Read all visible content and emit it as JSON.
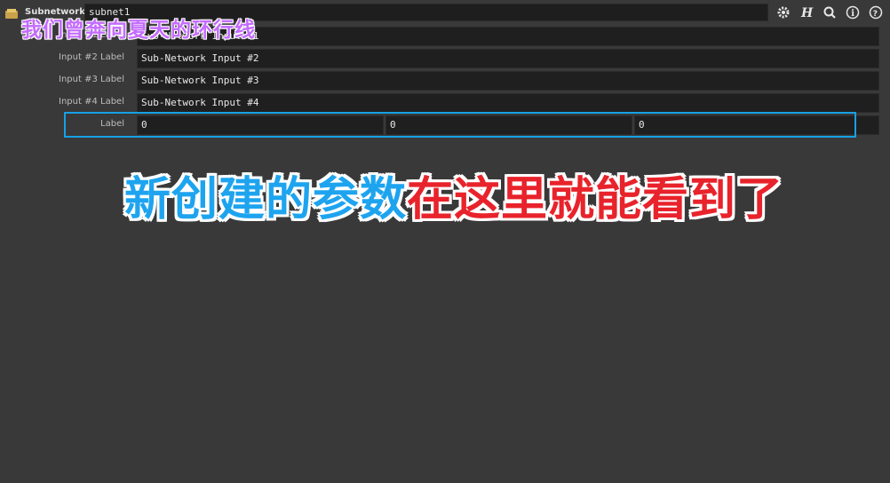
{
  "header": {
    "node_type": "Subnetwork",
    "node_name": "subnet1",
    "icons": [
      "gear-icon",
      "houdini-h-icon",
      "search-icon",
      "info-icon",
      "help-icon"
    ]
  },
  "params": [
    {
      "label": "Input #1 Label",
      "value": "Sub-Network Input #1"
    },
    {
      "label": "Input #2 Label",
      "value": "Sub-Network Input #2"
    },
    {
      "label": "Input #3 Label",
      "value": "Sub-Network Input #3"
    },
    {
      "label": "Input #4 Label",
      "value": "Sub-Network Input #4"
    }
  ],
  "vector_param": {
    "label": "Label",
    "values": [
      "0",
      "0",
      "0"
    ]
  },
  "overlay": {
    "top_subtitle": "我们曾奔向夏天的环行线",
    "caption_blue": "新创建的参数",
    "caption_red": "在这里就能看到了"
  },
  "colors": {
    "highlight": "#17a0e6",
    "caption_blue": "#1ea4ef",
    "caption_red": "#e8232b",
    "subtitle": "#c46cff"
  }
}
